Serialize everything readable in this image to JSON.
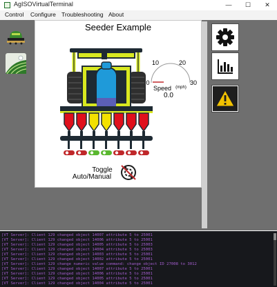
{
  "window": {
    "title": "AgISOVirtualTerminal",
    "controls": {
      "minimize": "—",
      "maximize": "☐",
      "close": "✕"
    }
  },
  "menu": {
    "items": [
      {
        "label": "Control"
      },
      {
        "label": "Configure"
      },
      {
        "label": "Troubleshooting"
      },
      {
        "label": "About"
      }
    ]
  },
  "vt": {
    "title": "Seeder Example",
    "speed": {
      "label": "Speed",
      "unit": "(mph)",
      "value": "0.0",
      "gauge_labels": [
        "0",
        "10",
        "20",
        "30"
      ]
    },
    "toggle_label_line1": "Toggle",
    "toggle_label_line2": "Auto/Manual",
    "section_states": [
      "red",
      "red",
      "green",
      "green",
      "red",
      "red",
      "red"
    ],
    "hopper_colors": [
      "#e0101c",
      "#e0101c",
      "#f3e100",
      "#f3e100",
      "#e0101c",
      "#e0101c",
      "#e0101c"
    ],
    "colors": {
      "frame_dark": "#1e2a33",
      "tire": "#2f2f2f",
      "cab": "#d8e820",
      "tank": "#1f9ad9",
      "tank_cap": "#5b5fb6",
      "row_green": "#5ab830",
      "row_red": "#c0282a"
    }
  },
  "soft_keys_left": [
    {
      "icon": "implement-icon"
    },
    {
      "icon": "field-icon"
    }
  ],
  "soft_keys_right": [
    {
      "icon": "gear-icon"
    },
    {
      "icon": "bar-chart-icon"
    },
    {
      "icon": "warning-icon"
    }
  ],
  "console": {
    "lines": [
      "[VT Server]: Client 129 changed object 14007 attribute 5 to 25001",
      "[VT Server]: Client 129 changed object 14006 attribute 5 to 25001",
      "[VT Server]: Client 129 changed object 14005 attribute 5 to 25003",
      "[VT Server]: Client 129 changed object 14004 attribute 5 to 25003",
      "[VT Server]: Client 129 changed object 14003 attribute 5 to 25001",
      "[VT Server]: Client 129 changed object 14002 attribute 5 to 25001",
      "[VT Server]: Client 129 change numeric value command: change object ID 27008 to 3012",
      "[VT Server]: Client 129 changed object 14007 attribute 5 to 25001",
      "[VT Server]: Client 129 changed object 14006 attribute 5 to 25001",
      "[VT Server]: Client 129 changed object 14005 attribute 5 to 25001",
      "[VT Server]: Client 129 changed object 14004 attribute 5 to 25001"
    ]
  }
}
